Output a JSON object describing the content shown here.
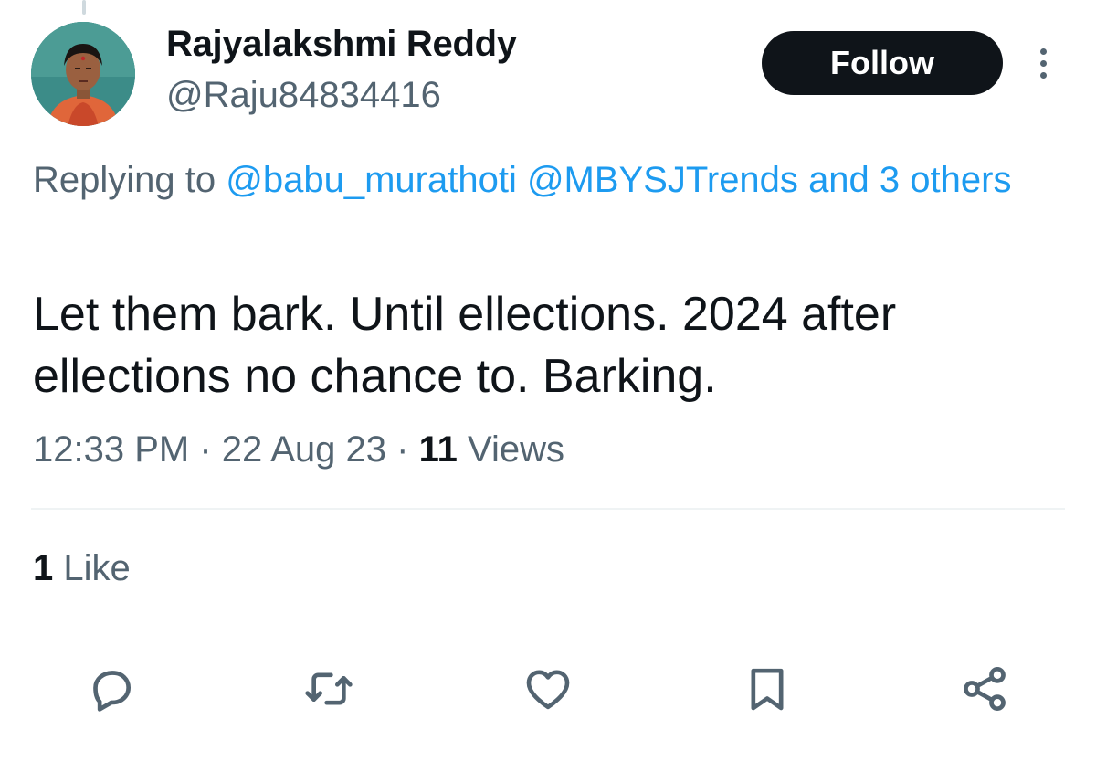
{
  "author": {
    "display_name": "Rajyalakshmi Reddy",
    "handle": "@Raju84834416"
  },
  "follow_button": {
    "label": "Follow"
  },
  "replying": {
    "prefix": "Replying to",
    "mentions": [
      "@babu_murathoti",
      "@MBYSJTrends"
    ],
    "others": "and 3 others"
  },
  "tweet": {
    "text": "Let them bark. Until ellections. 2024 after ellections no chance to. Barking."
  },
  "meta": {
    "time": "12:33 PM",
    "separator": "·",
    "date": "22 Aug 23",
    "views_count": "11",
    "views_label": "Views"
  },
  "stats": {
    "likes_count": "1",
    "likes_label": "Like"
  },
  "actions": [
    {
      "name": "reply",
      "icon": "reply-icon"
    },
    {
      "name": "retweet",
      "icon": "retweet-icon"
    },
    {
      "name": "like",
      "icon": "heart-icon"
    },
    {
      "name": "bookmark",
      "icon": "bookmark-icon"
    },
    {
      "name": "share",
      "icon": "share-icon"
    }
  ],
  "colors": {
    "text_primary": "#0f1419",
    "text_secondary": "#536471",
    "link": "#1d9bf0",
    "button_bg": "#0f1419",
    "divider": "#eff3f4"
  }
}
